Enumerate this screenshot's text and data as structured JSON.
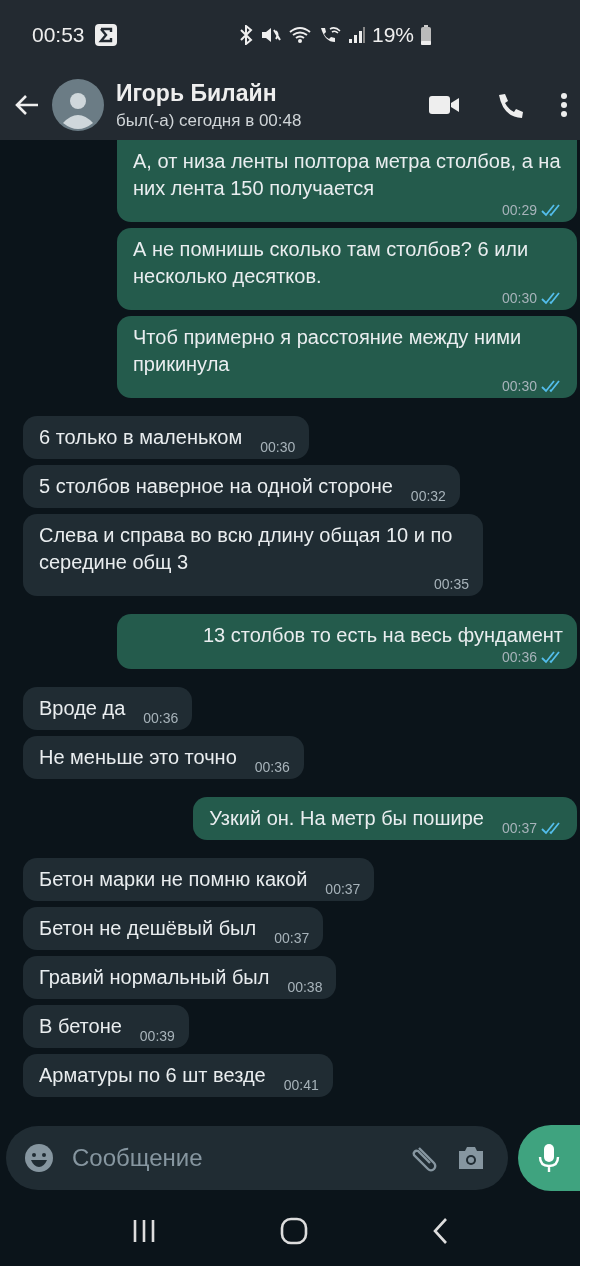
{
  "status_bar": {
    "time": "00:53",
    "battery_percent": "19%"
  },
  "header": {
    "contact_name": "Игорь Билайн",
    "last_seen": "был(-а) сегодня в 00:48"
  },
  "messages": [
    {
      "outgoing": true,
      "text": "А, от низа ленты полтора метра столбов, а на них лента 150 получается",
      "time": "00:29",
      "read": true
    },
    {
      "outgoing": true,
      "text": "А не помнишь сколько там столбов? 6 или несколько десятков.",
      "time": "00:30",
      "read": true
    },
    {
      "outgoing": true,
      "text": "Чтоб примерно я расстояние между ними прикинула",
      "time": "00:30",
      "read": true
    },
    {
      "outgoing": false,
      "text": "6 только в маленьком",
      "time": "00:30"
    },
    {
      "outgoing": false,
      "text": "5 столбов наверное на одной стороне",
      "time": "00:32"
    },
    {
      "outgoing": false,
      "text": "Слева и справа во всю длину общая 10  и по середине общ 3",
      "time": "00:35"
    },
    {
      "outgoing": true,
      "text": "13 столбов то есть на весь фундамент",
      "time": "00:36",
      "read": true
    },
    {
      "outgoing": false,
      "text": "Вроде да",
      "time": "00:36"
    },
    {
      "outgoing": false,
      "text": "Не меньше это точно",
      "time": "00:36"
    },
    {
      "outgoing": true,
      "text": "Узкий он. На метр бы пошире",
      "time": "00:37",
      "read": true
    },
    {
      "outgoing": false,
      "text": "Бетон марки не помню какой",
      "time": "00:37"
    },
    {
      "outgoing": false,
      "text": "Бетон не дешёвый был",
      "time": "00:37"
    },
    {
      "outgoing": false,
      "text": "Гравий нормальный был",
      "time": "00:38"
    },
    {
      "outgoing": false,
      "text": "В бетоне",
      "time": "00:39"
    },
    {
      "outgoing": false,
      "text": "Арматуры по 6 шт везде",
      "time": "00:41"
    }
  ],
  "composer": {
    "placeholder": "Сообщение"
  }
}
